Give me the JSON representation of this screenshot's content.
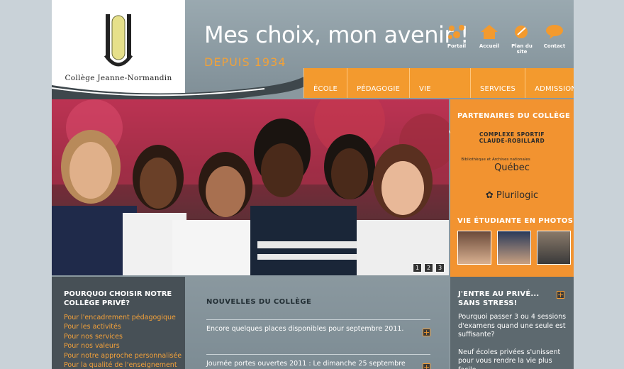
{
  "header": {
    "college_name": "Collège Jeanne-Normandin",
    "slogan": "Mes choix, mon avenir !",
    "since": "DEPUIS 1934"
  },
  "top_links": [
    {
      "label": "Portail",
      "icon": "portal-icon"
    },
    {
      "label": "Accueil",
      "icon": "home-icon"
    },
    {
      "label": "Plan du site",
      "icon": "sitemap-icon"
    },
    {
      "label": "Contact",
      "icon": "contact-bubble-icon"
    }
  ],
  "nav": [
    "ÉCOLE",
    "PÉDAGOGIE",
    "VIE ÉTUDIANTE",
    "SERVICES",
    "ADMISSION"
  ],
  "slider": {
    "pages": [
      "1",
      "2",
      "3"
    ]
  },
  "partners": {
    "title": "PARTENAIRES DU COLLÈGE",
    "logo1_line1": "COMPLEXE SPORTIF",
    "logo1_line2": "CLAUDE-ROBILLARD",
    "logo2_small": "Bibliothèque et Archives nationales",
    "logo2_main": "Québec",
    "logo3": "Plurilogic"
  },
  "photos": {
    "title": "VIE ÉTUDIANTE EN PHOTOS"
  },
  "share": {
    "plus": "+1",
    "count": "7"
  },
  "why": {
    "title_line1": "POURQUOI CHOISIR NOTRE",
    "title_line2": "COLLÈGE PRIVÉ?",
    "links": [
      "Pour l'encadrement pédagogique",
      "Pour les activités",
      "Pour nos services",
      "Pour nos valeurs",
      "Pour notre approche personnalisée",
      "Pour la qualité de l'enseignement"
    ]
  },
  "news": {
    "title": "NOUVELLES DU COLLÈGE",
    "items": [
      "Encore quelques places disponibles pour septembre 2011.",
      "Journée portes ouvertes 2011 : Le dimanche 25 septembre"
    ]
  },
  "private": {
    "title_line1": "J'ENTRE AU PRIVÉ...",
    "title_line2": "SANS STRESS!",
    "text1": "Pourquoi passer 3 ou 4 sessions d'examens quand une seule est suffisante?",
    "text2": "Neuf écoles privées s'unissent pour vous rendre la vie plus facile."
  },
  "colors": {
    "accent": "#f39a2e",
    "header": "#8a989f",
    "dark_panel": "#475056"
  }
}
